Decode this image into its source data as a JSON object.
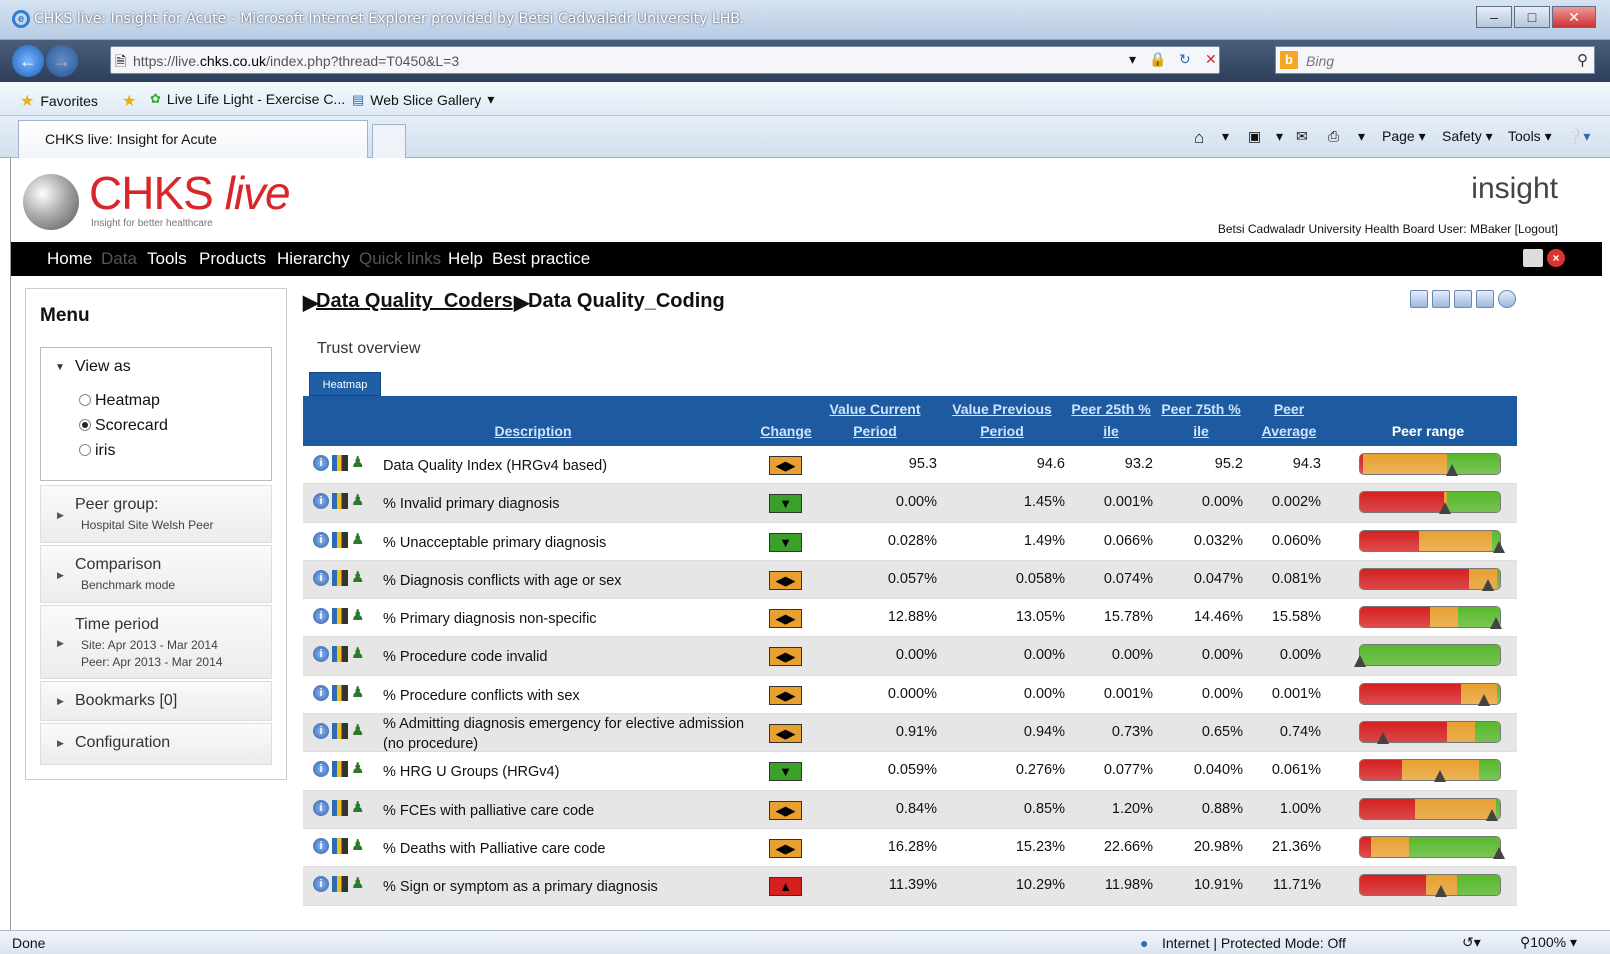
{
  "window": {
    "title": "CHKS live: Insight for Acute - Microsoft Internet Explorer provided by Betsi Cadwaladr University LHB."
  },
  "address": {
    "url_prefix": "https://live.",
    "url_domain": "chks.co.uk",
    "url_path": "/index.php?thread=T0450&L=3",
    "search_placeholder": "Bing"
  },
  "favorites": {
    "label": "Favorites",
    "items": [
      "Live Life Light - Exercise C...",
      "Web Slice Gallery"
    ]
  },
  "tab": {
    "title": "CHKS live: Insight for Acute"
  },
  "commands": {
    "page": "Page",
    "safety": "Safety",
    "tools": "Tools"
  },
  "brand": {
    "name": "CHKS",
    "name_italic": "live",
    "tagline": "Insight for better healthcare",
    "product": "insight",
    "user_line": "Betsi Cadwaladr University Health Board User: MBaker [Logout]"
  },
  "nav": [
    {
      "label": "Home",
      "enabled": true
    },
    {
      "label": "Data",
      "enabled": false
    },
    {
      "label": "Tools",
      "enabled": true
    },
    {
      "label": "Products",
      "enabled": true
    },
    {
      "label": "Hierarchy",
      "enabled": true
    },
    {
      "label": "Quick links",
      "enabled": false
    },
    {
      "label": "Help",
      "enabled": true
    },
    {
      "label": "Best practice",
      "enabled": true
    }
  ],
  "menu": {
    "title": "Menu",
    "view_as": {
      "label": "View as",
      "options": [
        "Heatmap",
        "Scorecard",
        "iris"
      ],
      "selected": "Scorecard"
    },
    "peer_group": {
      "label": "Peer group:",
      "value": "Hospital Site Welsh Peer"
    },
    "comparison": {
      "label": "Comparison",
      "value": "Benchmark mode"
    },
    "time_period": {
      "label": "Time period",
      "site": "Site: Apr 2013 - Mar 2014",
      "peer": "Peer: Apr 2013 - Mar 2014"
    },
    "bookmarks": "Bookmarks [0]",
    "configuration": "Configuration"
  },
  "breadcrumb": {
    "parent": "Data Quality_Coders",
    "current": "Data Quality_Coding"
  },
  "section": {
    "title": "Trust overview",
    "tab": "Heatmap"
  },
  "table": {
    "headers": {
      "description": "Description",
      "change": "Change",
      "value_current": "Value Current Period",
      "value_previous": "Value Previous Period",
      "peer25": "Peer 25th % ile",
      "peer75": "Peer 75th % ile",
      "peer_avg": "Peer Average",
      "peer_range": "Peer range"
    },
    "rows": [
      {
        "desc": "Data Quality Index (HRGv4 based)",
        "change": "same",
        "change_glyph": "◀▶",
        "cur": "95.3",
        "prev": "94.6",
        "p25": "93.2",
        "p75": "95.2",
        "avg": "94.3",
        "range": [
          0.02,
          0.6,
          0.38
        ],
        "colors": [
          "#d62020",
          "#e8a030",
          "#58b82c"
        ],
        "marker": 0.65
      },
      {
        "desc": "% Invalid primary diagnosis",
        "change": "down",
        "change_glyph": "▼",
        "cur": "0.00%",
        "prev": "1.45%",
        "p25": "0.001%",
        "p75": "0.00%",
        "avg": "0.002%",
        "range": [
          0.6,
          0.02,
          0.38
        ],
        "colors": [
          "#d62020",
          "#e8a030",
          "#58b82c"
        ],
        "marker": 0.6
      },
      {
        "desc": "% Unacceptable primary diagnosis",
        "change": "down",
        "change_glyph": "▼",
        "cur": "0.028%",
        "prev": "1.49%",
        "p25": "0.066%",
        "p75": "0.032%",
        "avg": "0.060%",
        "range": [
          0.42,
          0.52,
          0.06
        ],
        "colors": [
          "#d62020",
          "#e8a030",
          "#58b82c"
        ],
        "marker": 0.98
      },
      {
        "desc": "% Diagnosis conflicts with age or sex",
        "change": "same",
        "change_glyph": "◀▶",
        "cur": "0.057%",
        "prev": "0.058%",
        "p25": "0.074%",
        "p75": "0.047%",
        "avg": "0.081%",
        "range": [
          0.78,
          0.2,
          0.02
        ],
        "colors": [
          "#d62020",
          "#e8a030",
          "#58b82c"
        ],
        "marker": 0.9
      },
      {
        "desc": "% Primary diagnosis non-specific",
        "change": "same",
        "change_glyph": "◀▶",
        "cur": "12.88%",
        "prev": "13.05%",
        "p25": "15.78%",
        "p75": "14.46%",
        "avg": "15.58%",
        "range": [
          0.5,
          0.2,
          0.3
        ],
        "colors": [
          "#d62020",
          "#e8a030",
          "#58b82c"
        ],
        "marker": 0.96
      },
      {
        "desc": "% Procedure code invalid",
        "change": "same",
        "change_glyph": "◀▶",
        "cur": "0.00%",
        "prev": "0.00%",
        "p25": "0.00%",
        "p75": "0.00%",
        "avg": "0.00%",
        "range": [
          0,
          0,
          1
        ],
        "colors": [
          "#d62020",
          "#e8a030",
          "#58b82c"
        ],
        "marker": 0.0
      },
      {
        "desc": "% Procedure conflicts with sex",
        "change": "same",
        "change_glyph": "◀▶",
        "cur": "0.000%",
        "prev": "0.00%",
        "p25": "0.001%",
        "p75": "0.00%",
        "avg": "0.001%",
        "range": [
          0.72,
          0.26,
          0.02
        ],
        "colors": [
          "#d62020",
          "#e8a030",
          "#58b82c"
        ],
        "marker": 0.87
      },
      {
        "desc": "% Admitting diagnosis emergency for elective admission (no procedure)",
        "change": "same",
        "change_glyph": "◀▶",
        "cur": "0.91%",
        "prev": "0.94%",
        "p25": "0.73%",
        "p75": "0.65%",
        "avg": "0.74%",
        "range": [
          0.62,
          0.2,
          0.18
        ],
        "colors": [
          "#d62020",
          "#e8a030",
          "#58b82c"
        ],
        "marker": 0.16
      },
      {
        "desc": "% HRG U Groups (HRGv4)",
        "change": "down",
        "change_glyph": "▼",
        "cur": "0.059%",
        "prev": "0.276%",
        "p25": "0.077%",
        "p75": "0.040%",
        "avg": "0.061%",
        "range": [
          0.3,
          0.55,
          0.15
        ],
        "colors": [
          "#d62020",
          "#e8a030",
          "#58b82c"
        ],
        "marker": 0.56
      },
      {
        "desc": "% FCEs with palliative care code",
        "change": "same",
        "change_glyph": "◀▶",
        "cur": "0.84%",
        "prev": "0.85%",
        "p25": "1.20%",
        "p75": "0.88%",
        "avg": "1.00%",
        "range": [
          0.39,
          0.58,
          0.03
        ],
        "colors": [
          "#d62020",
          "#e8a030",
          "#58b82c"
        ],
        "marker": 0.93
      },
      {
        "desc": "% Deaths with Palliative care code",
        "change": "same",
        "change_glyph": "◀▶",
        "cur": "16.28%",
        "prev": "15.23%",
        "p25": "22.66%",
        "p75": "20.98%",
        "avg": "21.36%",
        "range": [
          0.08,
          0.27,
          0.65
        ],
        "colors": [
          "#d62020",
          "#e8a030",
          "#58b82c"
        ],
        "marker": 0.98
      },
      {
        "desc": "% Sign or symptom as a primary diagnosis",
        "change": "up",
        "change_glyph": "▲",
        "cur": "11.39%",
        "prev": "10.29%",
        "p25": "11.98%",
        "p75": "10.91%",
        "avg": "11.71%",
        "range": [
          0.47,
          0.22,
          0.31
        ],
        "colors": [
          "#d62020",
          "#e8a030",
          "#58b82c"
        ],
        "marker": 0.57
      }
    ]
  },
  "change_colors": {
    "same": "#e8a030",
    "down": "#3aa02a",
    "up": "#d62020"
  },
  "status": {
    "left": "Done",
    "zone": "Internet | Protected Mode: Off",
    "zoom": "100%"
  }
}
